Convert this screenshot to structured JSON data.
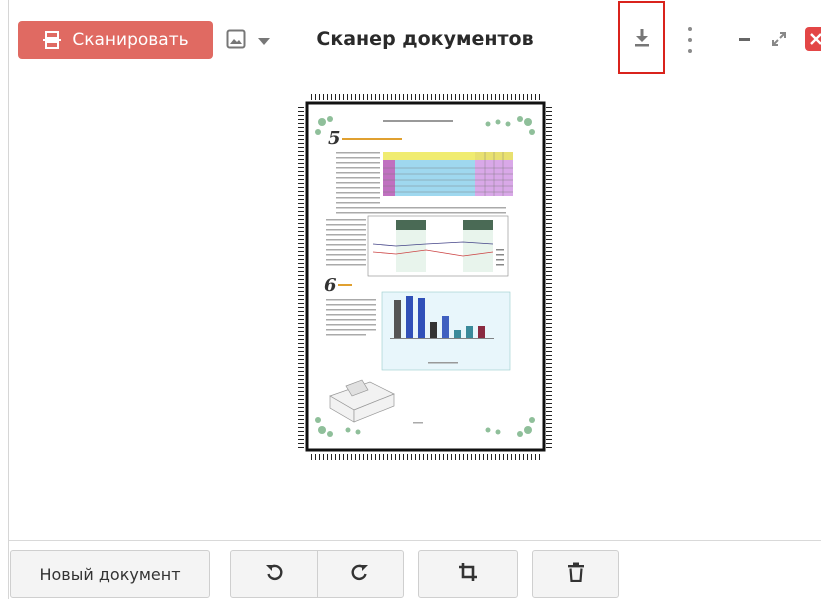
{
  "header": {
    "scan_label": "Сканировать",
    "title": "Сканер документов",
    "icons": {
      "scan": "scanner-icon",
      "image": "image-icon",
      "dropdown": "chevron-down-icon",
      "download": "download-icon",
      "menu": "more-vertical-icon",
      "minimize": "minimize-icon",
      "maximize": "maximize-icon",
      "close": "close-icon"
    },
    "accent_color": "#e06a62",
    "highlight_color": "#d9231c",
    "close_color": "#e34646"
  },
  "preview": {
    "page_number": "6"
  },
  "footer": {
    "new_document_label": "Новый документ",
    "icons": [
      "rotate-left-icon",
      "rotate-right-icon",
      "crop-icon",
      "trash-icon"
    ]
  }
}
